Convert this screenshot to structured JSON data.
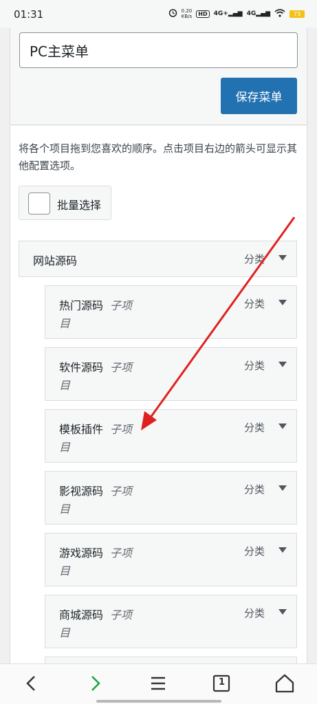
{
  "status_bar": {
    "time": "01:31",
    "speed_value": "0.20",
    "speed_unit": "KB/s",
    "hd": "HD",
    "signal1": "4G+",
    "signal2": "4G",
    "battery": "73"
  },
  "menu_name": {
    "value": "PC主菜单"
  },
  "save_button": {
    "label": "保存菜单"
  },
  "instructions": "将各个项目拖到您喜欢的顺序。点击项目右边的箭头可显示其他配置选项。",
  "bulk_select": {
    "label": "批量选择"
  },
  "menu_items": [
    {
      "title": "网站源码",
      "sub": "",
      "type": "分类"
    },
    {
      "title": "热门源码",
      "sub": "子项",
      "sub_tail": "目",
      "type": "分类"
    },
    {
      "title": "软件源码",
      "sub": "子项",
      "sub_tail": "目",
      "type": "分类"
    },
    {
      "title": "模板插件",
      "sub": "子项",
      "sub_tail": "目",
      "type": "分类"
    },
    {
      "title": "影视源码",
      "sub": "子项",
      "sub_tail": "目",
      "type": "分类"
    },
    {
      "title": "游戏源码",
      "sub": "子项",
      "sub_tail": "目",
      "type": "分类"
    },
    {
      "title": "商城源码",
      "sub": "子项",
      "sub_tail": "目",
      "type": "分类"
    }
  ],
  "bottom_nav": {
    "tab_count": "1"
  },
  "colors": {
    "accent": "#2271b1",
    "annotation_arrow": "#e02020",
    "forward_arrow": "#1aa33a"
  }
}
